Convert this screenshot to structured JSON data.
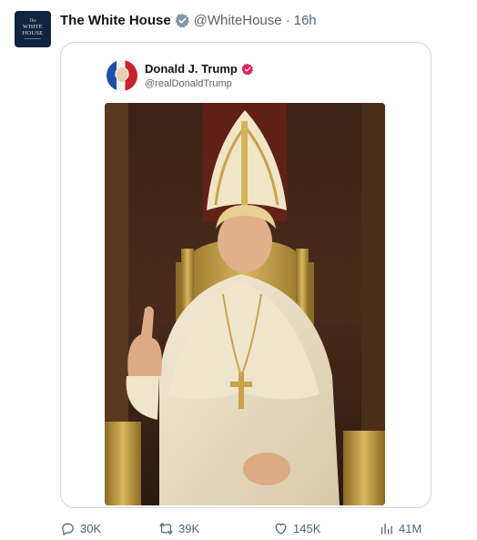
{
  "post": {
    "author": {
      "display_name": "The White House",
      "handle": "@WhiteHouse",
      "separator": "·",
      "time": "16h",
      "avatar_text": {
        "the": "The",
        "line1": "WHITE",
        "line2": "HOUSE"
      },
      "verified_badge_color": "#829aab",
      "avatar_bg": "#10233f"
    },
    "quoted": {
      "display_name": "Donald J. Trump",
      "handle": "@realDonaldTrump",
      "badge_color": "#e0245e"
    },
    "actions": {
      "reply_count": "30K",
      "repost_count": "39K",
      "like_count": "145K",
      "views_count": "41M"
    }
  },
  "icons": {
    "verified": "verified-badge-icon",
    "reply": "reply-icon",
    "repost": "repost-icon",
    "like": "heart-icon",
    "views": "views-chart-icon"
  },
  "colors": {
    "text_primary": "#0f1419",
    "text_secondary": "#536471",
    "border": "#cfd9de"
  }
}
